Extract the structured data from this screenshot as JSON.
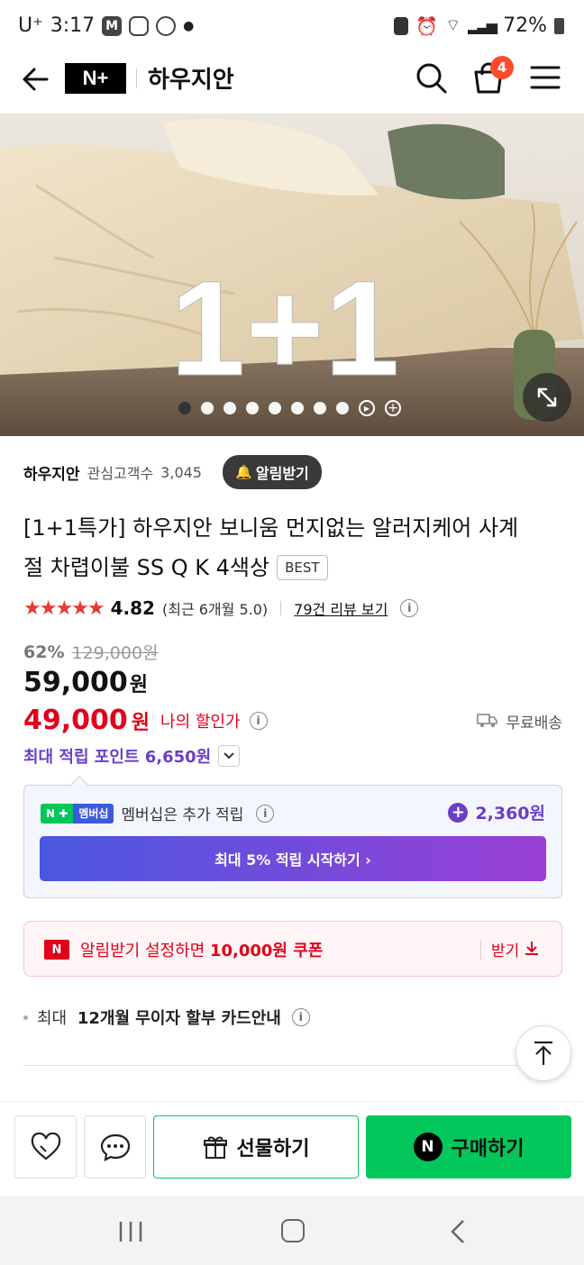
{
  "status_bar": {
    "carrier": "U⁺",
    "time": "3:17",
    "battery": "72%"
  },
  "header": {
    "brand_logo": "N+",
    "store_name": "하우지안",
    "cart_count": "4"
  },
  "hero": {
    "overlay_text": "1+1",
    "slide_count": 8,
    "active_slide": 1
  },
  "store": {
    "name": "하우지안",
    "followers_label": "관심고객수",
    "followers": "3,045",
    "alert_button": "알림받기"
  },
  "product": {
    "title": "[1+1특가] 하우지안 보니움 먼지없는 알러지케어 사계절 차렵이불 SS Q K 4색상",
    "title_line1": "[1+1특가] 하우지안 보니움 먼지없는 알러지케어 사계",
    "title_line2": "절 차렵이불 SS Q K 4색상",
    "badge": "BEST",
    "rating": "4.82",
    "rating_recent": "(최근 6개월 5.0)",
    "review_link": "79건 리뷰 보기"
  },
  "price": {
    "discount_rate": "62%",
    "original_price": "129,000원",
    "sale_price": "59,000",
    "sale_unit": "원",
    "my_price": "49,000",
    "my_price_unit": "원",
    "my_price_label": "나의 할인가",
    "shipping": "무료배송",
    "max_points": "최대 적립 포인트 6,650원"
  },
  "membership": {
    "badge_label": "멤버십",
    "text": "멤버십은 추가 적립",
    "points": "2,360원",
    "cta": "최대 5% 적립 시작하기 ›"
  },
  "coupon": {
    "text_prefix": "알림받기 설정하면 ",
    "amount": "10,000원 쿠폰",
    "action": "받기"
  },
  "installment": {
    "prefix": "최대 ",
    "bold": "12개월 무이자 할부 카드안내"
  },
  "bottom_bar": {
    "gift_label": "선물하기",
    "buy_label": "구매하기"
  },
  "colors": {
    "naver_green": "#03c75a",
    "purple": "#6a3fc7",
    "red": "#e0001b",
    "membership_gradient_start": "#4a57e0",
    "membership_gradient_end": "#9a3fd6"
  }
}
